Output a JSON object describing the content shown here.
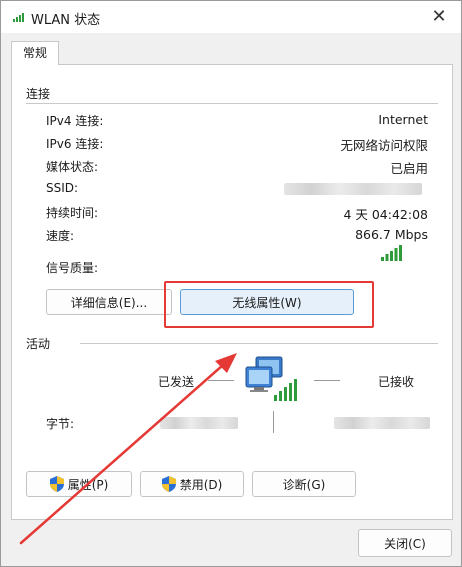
{
  "window": {
    "title": "WLAN 状态",
    "close_glyph": "✕"
  },
  "tabs": [
    {
      "label": "常规"
    }
  ],
  "connection": {
    "header": "连接",
    "rows": [
      {
        "label": "IPv4 连接:",
        "value": "Internet"
      },
      {
        "label": "IPv6 连接:",
        "value": "无网络访问权限"
      },
      {
        "label": "媒体状态:",
        "value": "已启用"
      },
      {
        "label": "SSID:",
        "value": ""
      },
      {
        "label": "持续时间:",
        "value": "4 天 04:42:08"
      },
      {
        "label": "速度:",
        "value": "866.7 Mbps"
      }
    ],
    "signal_label": "信号质量:",
    "signal_bars": 5,
    "signal_level": 1.0
  },
  "buttons": {
    "details": "详细信息(E)...",
    "wireless_props": "无线属性(W)",
    "properties": "属性(P)",
    "disable": "禁用(D)",
    "diagnose": "诊断(G)",
    "close": "关闭(C)"
  },
  "activity": {
    "header": "活动",
    "sent_label": "已发送",
    "received_label": "已接收",
    "bytes_label": "字节:"
  },
  "colors": {
    "accent_blue": "#5b9bd5",
    "annotation_red": "#e53935",
    "signal_green": "#2e9c3a"
  },
  "icons": {
    "title": "wifi-signal-icon",
    "network": "network-computers-icon",
    "shield": "uac-shield-icon"
  }
}
